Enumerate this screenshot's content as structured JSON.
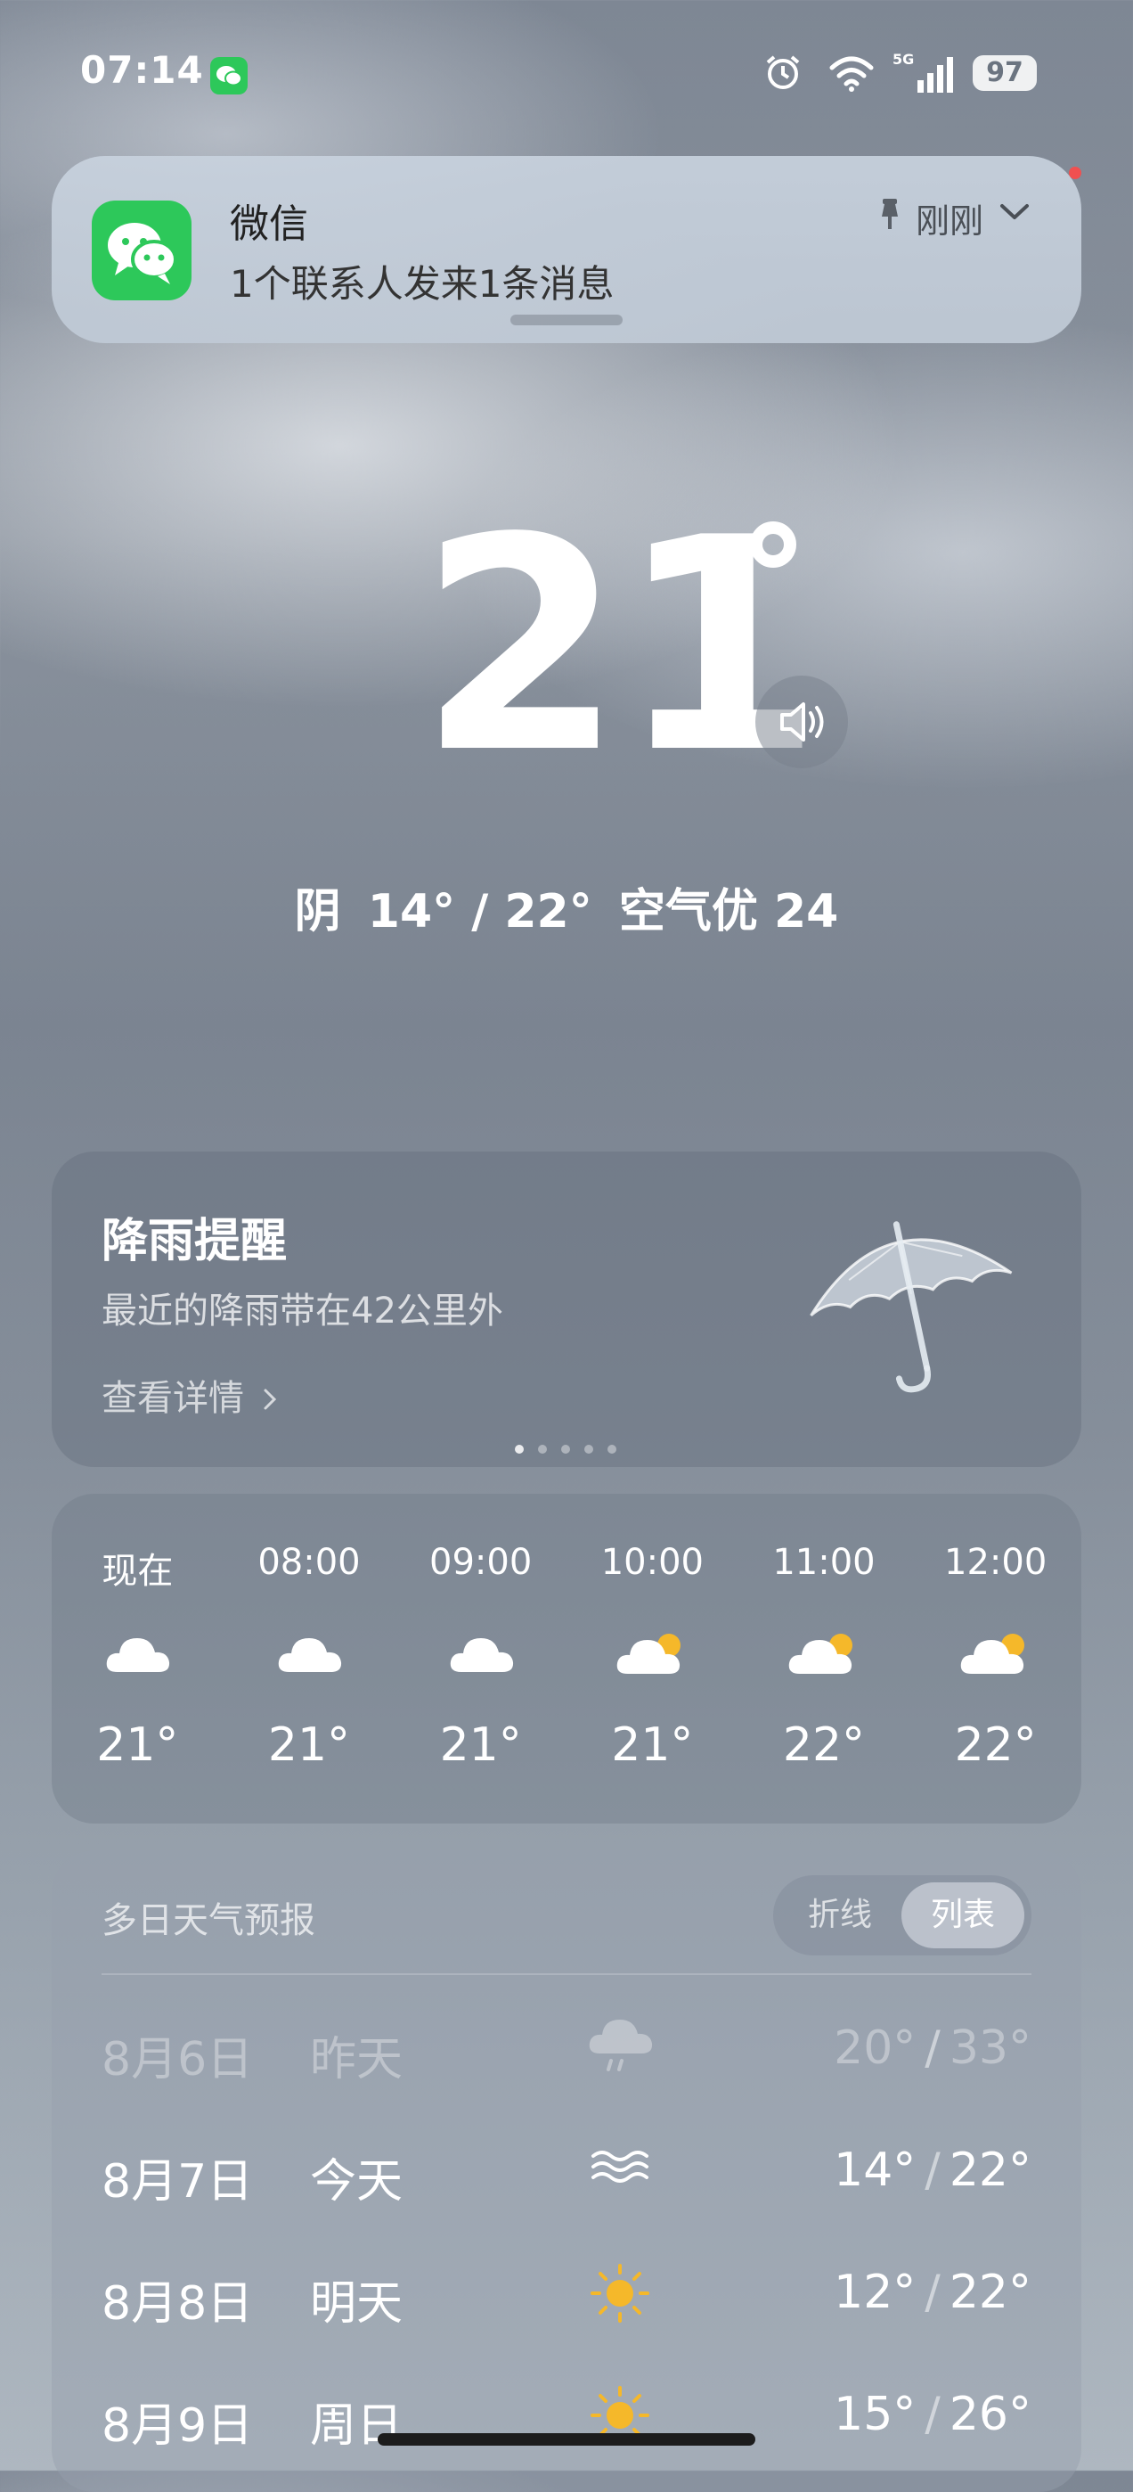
{
  "status_bar": {
    "time": "07:14",
    "battery": "97",
    "network": "5G"
  },
  "notification": {
    "app": "微信",
    "message": "1个联系人发来1条消息",
    "time": "刚刚"
  },
  "current": {
    "temperature": "21",
    "summary": {
      "condition": "阴",
      "range": "14° / 22°",
      "air": "空气优 24"
    }
  },
  "rain_alert": {
    "title": "降雨提醒",
    "subtitle": "最近的降雨带在42公里外",
    "link": "查看详情"
  },
  "hourly": [
    {
      "time": "现在",
      "icon": "cloud-icon",
      "temp": "21°"
    },
    {
      "time": "08:00",
      "icon": "cloud-icon",
      "temp": "21°"
    },
    {
      "time": "09:00",
      "icon": "cloud-icon",
      "temp": "21°"
    },
    {
      "time": "10:00",
      "icon": "partly-cloudy-icon",
      "temp": "21°"
    },
    {
      "time": "11:00",
      "icon": "partly-cloudy-icon",
      "temp": "22°"
    },
    {
      "time": "12:00",
      "icon": "partly-cloudy-icon",
      "temp": "22°"
    }
  ],
  "daily": {
    "title": "多日天气预报",
    "toggle": {
      "chart": "折线",
      "list": "列表",
      "selected": "列表"
    },
    "rows": [
      {
        "date": "8月6日",
        "day": "昨天",
        "icon": "rain-icon",
        "low": "20°",
        "high": "33°",
        "past": true
      },
      {
        "date": "8月7日",
        "day": "今天",
        "icon": "haze-icon",
        "low": "14°",
        "high": "22°"
      },
      {
        "date": "8月8日",
        "day": "明天",
        "icon": "sun-icon",
        "low": "12°",
        "high": "22°"
      },
      {
        "date": "8月9日",
        "day": "周日",
        "icon": "sun-icon",
        "low": "15°",
        "high": "26°"
      }
    ]
  },
  "colors": {
    "wechat_green": "#2dc85a",
    "sun_yellow": "#f5b82a"
  }
}
